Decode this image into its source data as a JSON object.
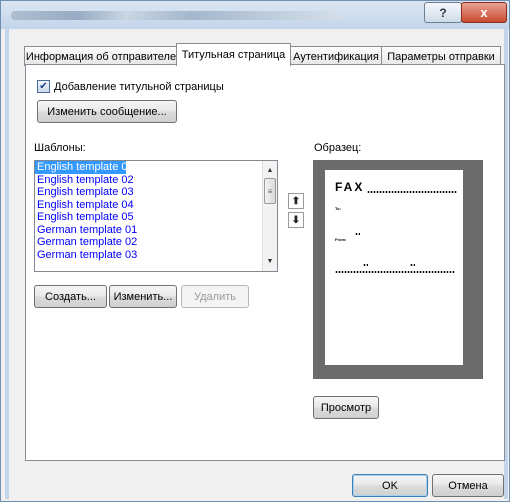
{
  "window": {
    "help_label": "?",
    "close_label": "x"
  },
  "tabs": [
    {
      "label": "Информация об отправителе",
      "active": false
    },
    {
      "label": "Титульная страница",
      "active": true
    },
    {
      "label": "Аутентификация",
      "active": false
    },
    {
      "label": "Параметры отправки",
      "active": false
    }
  ],
  "cover": {
    "checkbox_label": "Добавление титульной страницы",
    "checkbox_checked": true,
    "checkbox_mark": "✔",
    "edit_message_button": "Изменить сообщение..."
  },
  "templates": {
    "label": "Шаблоны:",
    "items": [
      "English template 01",
      "English template 02",
      "English template 03",
      "English template 04",
      "English template 05",
      "German template 01",
      "German template 02",
      "German template 03"
    ],
    "selected_index": 0,
    "create_button": "Создать...",
    "edit_button": "Изменить...",
    "delete_button": "Удалить"
  },
  "preview": {
    "label": "Образец:",
    "fax_title": "FAX",
    "to_label": "To:",
    "from_label": "From:",
    "preview_button": "Просмотр"
  },
  "footer": {
    "ok_button": "OK",
    "cancel_button": "Отмена"
  },
  "icons": {
    "move_up": "up-arrow-icon",
    "move_down": "down-arrow-icon",
    "scroll_up": "scroll-up-icon",
    "scroll_down": "scroll-down-icon",
    "help": "question-icon",
    "close": "close-icon"
  },
  "colors": {
    "selection": "#3399ff",
    "list_text": "#0000ff",
    "preview_bg": "#6b6b6b"
  }
}
